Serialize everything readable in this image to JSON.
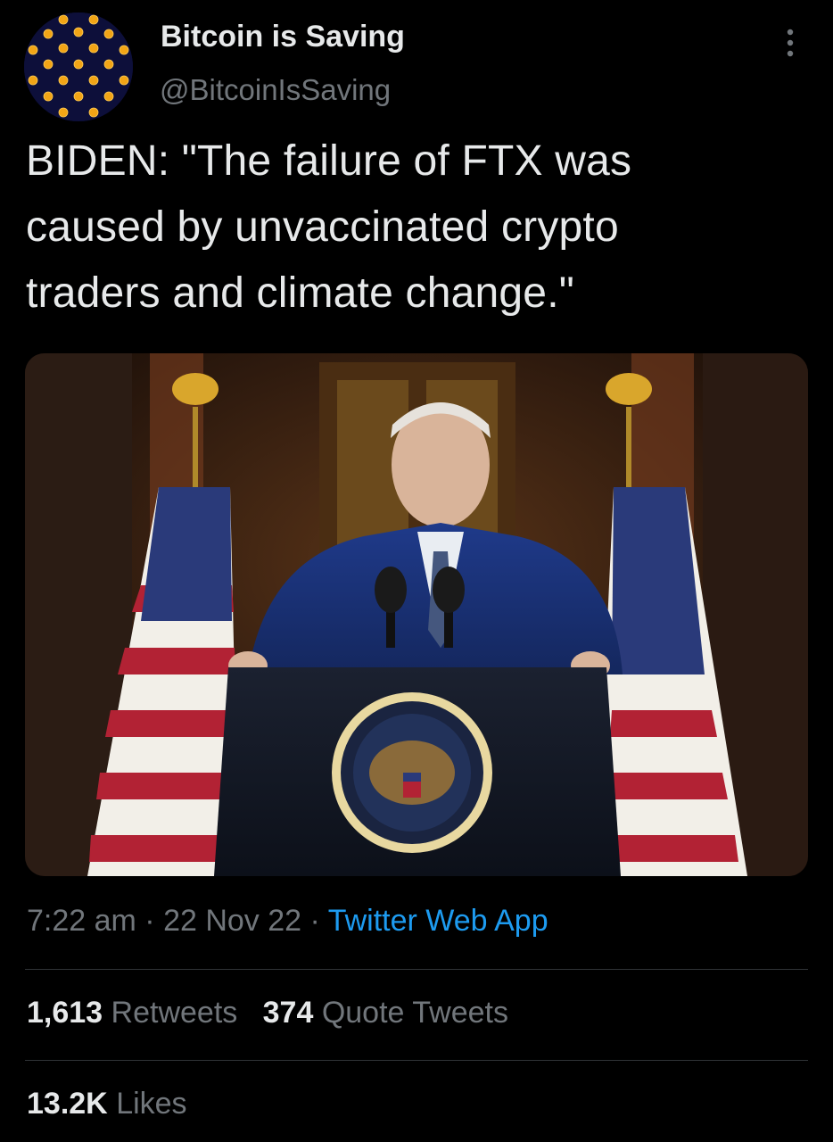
{
  "account": {
    "display_name": "Bitcoin is Saving",
    "handle": "@BitcoinIsSaving",
    "avatar_icon": "bitcoin-coins-pattern-icon"
  },
  "tweet": {
    "text": "BIDEN: \"The failure of FTX was\ncaused by unvaccinated crypto\ntraders and climate change.\"",
    "media_description": "photo-of-speaker-at-podium-with-flags"
  },
  "meta": {
    "time": "7:22 am",
    "separator1": " · ",
    "date": "22 Nov 22",
    "separator2": " · ",
    "source": "Twitter Web App"
  },
  "stats": {
    "retweets_count": "1,613",
    "retweets_label": "Retweets",
    "quotes_count": "374",
    "quotes_label": "Quote Tweets",
    "likes_count": "13.2K",
    "likes_label": "Likes"
  },
  "colors": {
    "background": "#000000",
    "primary_text": "#e7e9ea",
    "secondary_text": "#71767b",
    "link": "#1d9bf0",
    "divider": "#2f3336"
  }
}
